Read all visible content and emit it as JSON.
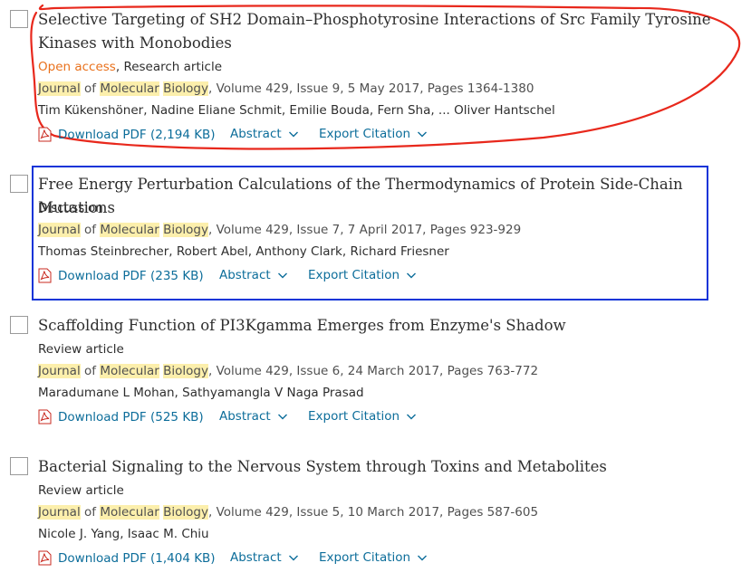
{
  "results": [
    {
      "title": "Selective Targeting of SH2 Domain–Phosphotyrosine Interactions of Src Family Tyrosine Kinases with Monobodies",
      "access": "Open access",
      "type_sep": ", ",
      "type": "Research article",
      "journal_word1": "Journal",
      "journal_of": " of ",
      "journal_word2": "Molecular",
      "journal_space": " ",
      "journal_word3": "Biology",
      "citation": ", Volume 429, Issue 9, 5 May 2017, Pages 1364-1380",
      "authors": "Tim Kükenshöner, Nadine Eliane Schmit, Emilie Bouda, Fern Sha, ... Oliver Hantschel",
      "download_label": "Download PDF (2,194 KB)",
      "abstract_label": "Abstract",
      "export_label": "Export Citation"
    },
    {
      "title": "Free Energy Perturbation Calculations of the Thermodynamics of Protein Side-Chain Mutations",
      "type": "Discussion",
      "journal_word1": "Journal",
      "journal_of": " of ",
      "journal_word2": "Molecular",
      "journal_space": " ",
      "journal_word3": "Biology",
      "citation": ", Volume 429, Issue 7, 7 April 2017, Pages 923-929",
      "authors": "Thomas Steinbrecher, Robert Abel, Anthony Clark, Richard Friesner",
      "download_label": "Download PDF (235 KB)",
      "abstract_label": "Abstract",
      "export_label": "Export Citation"
    },
    {
      "title": "Scaffolding Function of PI3Kgamma Emerges from Enzyme's Shadow",
      "type": "Review article",
      "journal_word1": "Journal",
      "journal_of": " of ",
      "journal_word2": "Molecular",
      "journal_space": " ",
      "journal_word3": "Biology",
      "citation": ", Volume 429, Issue 6, 24 March 2017, Pages 763-772",
      "authors": "Maradumane L Mohan, Sathyamangla V Naga Prasad",
      "download_label": "Download PDF (525 KB)",
      "abstract_label": "Abstract",
      "export_label": "Export Citation"
    },
    {
      "title": "Bacterial Signaling to the Nervous System through Toxins and Metabolites",
      "type": "Review article",
      "journal_word1": "Journal",
      "journal_of": " of ",
      "journal_word2": "Molecular",
      "journal_space": " ",
      "journal_word3": "Biology",
      "citation": ", Volume 429, Issue 5, 10 March 2017, Pages 587-605",
      "authors": "Nicole J. Yang, Isaac M. Chiu",
      "download_label": "Download PDF (1,404 KB)",
      "abstract_label": "Abstract",
      "export_label": "Export Citation"
    }
  ],
  "colors": {
    "link": "#0c6d9a",
    "open_access": "#e9711c",
    "highlight": "#fcefac",
    "annotation_red": "#e8281c",
    "annotation_blue": "#1034d8"
  },
  "icons": [
    "pdf-icon",
    "chevron-down-icon"
  ]
}
